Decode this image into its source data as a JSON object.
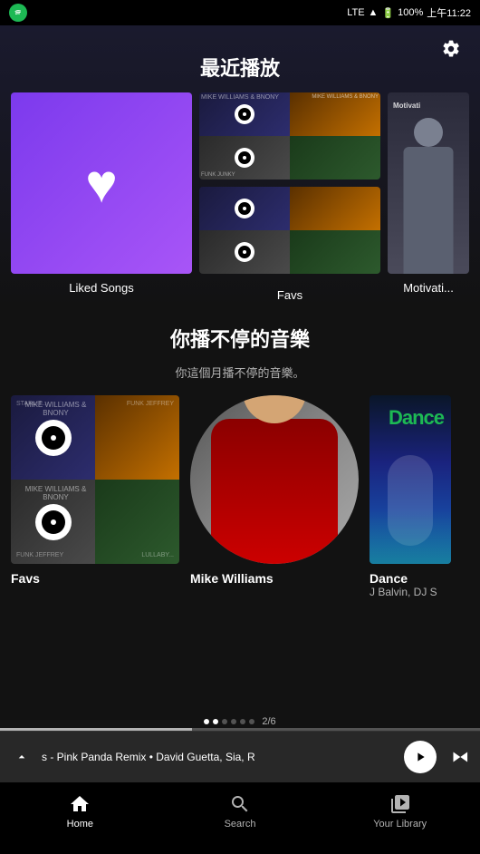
{
  "statusBar": {
    "carrier": "Spotify",
    "network": "LTE",
    "battery": "100%",
    "time": "上午11:22"
  },
  "settings": {
    "icon": "⚙"
  },
  "recentlyPlayed": {
    "title": "最近播放",
    "items": [
      {
        "id": "liked-songs",
        "label": "Liked Songs",
        "type": "liked"
      },
      {
        "id": "favs",
        "label": "Favs",
        "type": "favs"
      },
      {
        "id": "motivation",
        "label": "Motivati...",
        "type": "motivation"
      }
    ]
  },
  "youPlay": {
    "title": "你播不停的音樂",
    "subtitle": "你這個月播不停的音樂。",
    "items": [
      {
        "id": "favs2",
        "label": "Favs",
        "sublabel": "",
        "type": "favs"
      },
      {
        "id": "mike-williams",
        "label": "Mike Williams",
        "sublabel": "",
        "type": "artist"
      },
      {
        "id": "dance",
        "label": "Dance",
        "sublabel": "J Balvin, DJ S",
        "type": "dance"
      }
    ]
  },
  "nowPlaying": {
    "track": "s - Pink Panda Remix • David Guetta, Sia, R",
    "collapseIcon": "▲",
    "playIcon": "▶",
    "skipIcon": "⏭"
  },
  "progressBar": {
    "current": "2",
    "total": "6",
    "label": "2/6",
    "percent": 33
  },
  "bottomNav": {
    "items": [
      {
        "id": "home",
        "label": "Home",
        "icon": "home",
        "active": true
      },
      {
        "id": "search",
        "label": "Search",
        "icon": "search",
        "active": false
      },
      {
        "id": "library",
        "label": "Your Library",
        "icon": "library",
        "active": false
      }
    ]
  }
}
